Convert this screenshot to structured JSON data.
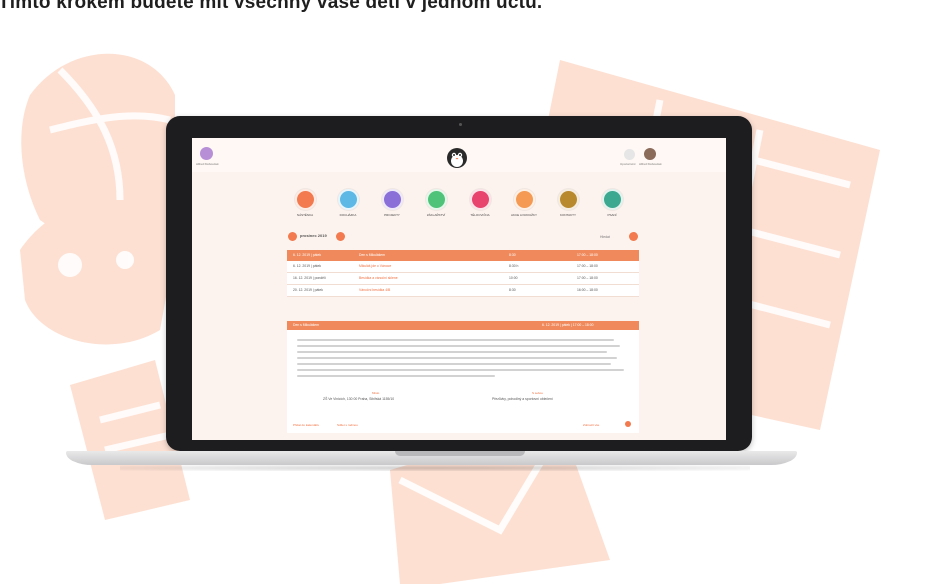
{
  "headline": "Tímto krokem budete mít všechny vaše děti v jednom účtu.",
  "colors": {
    "accent": "#f27a4e",
    "background_art": "#fde0d2",
    "screen_background": "#fdf3ee"
  },
  "app": {
    "header": {
      "left_user_label": "Alfred Klobouček",
      "right_items": [
        {
          "label": "Upozornění",
          "icon": "bell-icon"
        },
        {
          "label": "Alfred Klobouček",
          "icon": "avatar"
        }
      ],
      "logo_icon": "penguin-icon"
    },
    "menu": [
      {
        "label": "NÁSTĚNKA",
        "color": "#f27a4e"
      },
      {
        "label": "DOCHÁZKA",
        "color": "#5db8e6"
      },
      {
        "label": "PROJEKTY",
        "color": "#8a6fd8"
      },
      {
        "label": "ZÁKLAŘSTVÍ",
        "color": "#4fc37a"
      },
      {
        "label": "TĚLOCVIČNA",
        "color": "#e8426e"
      },
      {
        "label": "AKCE A KROUŽKY",
        "color": "#f49a54"
      },
      {
        "label": "KONTAKTY",
        "color": "#b9892e"
      },
      {
        "label": "PSANÍ",
        "color": "#3ca88f"
      }
    ],
    "month": {
      "label": "prosinec 2019",
      "right_label": "Hledat"
    },
    "table": {
      "headers": [
        "6. 12. 2019 | pátek",
        "Den s Mikulášem",
        "8:30",
        "17:00 – 18:00"
      ],
      "rows": [
        [
          "6. 12. 2019 | pátek",
          "Mikuláš jde o Vánoce",
          "8:30 h",
          "17:00 – 18:00"
        ],
        [
          "16. 12. 2019 | pondělí",
          "Besídka a vánoční sklene",
          "10:00",
          "17:00 – 18:00"
        ],
        [
          "20. 12. 2019 | pátek",
          "Vánoční besídka 4/B",
          "8:30",
          "16:00 – 18:00"
        ]
      ]
    },
    "detail": {
      "title": "Den s Mikulášem",
      "date": "6. 12. 2019 | pátek | 17:00 – 18:00",
      "place_label": "Místo",
      "place_value": "ZŠ Ve Vinicích, 130 00 Praha, Sibiřská 1155/10",
      "items_label": "S sebou",
      "items_value": "Přezůvky, pohodlný a sportovní oblečení",
      "footer_left": "Přidat do kalendáře",
      "footer_left_2": "Sdílet s rodinou",
      "footer_right": "Zobrazit vše"
    }
  }
}
